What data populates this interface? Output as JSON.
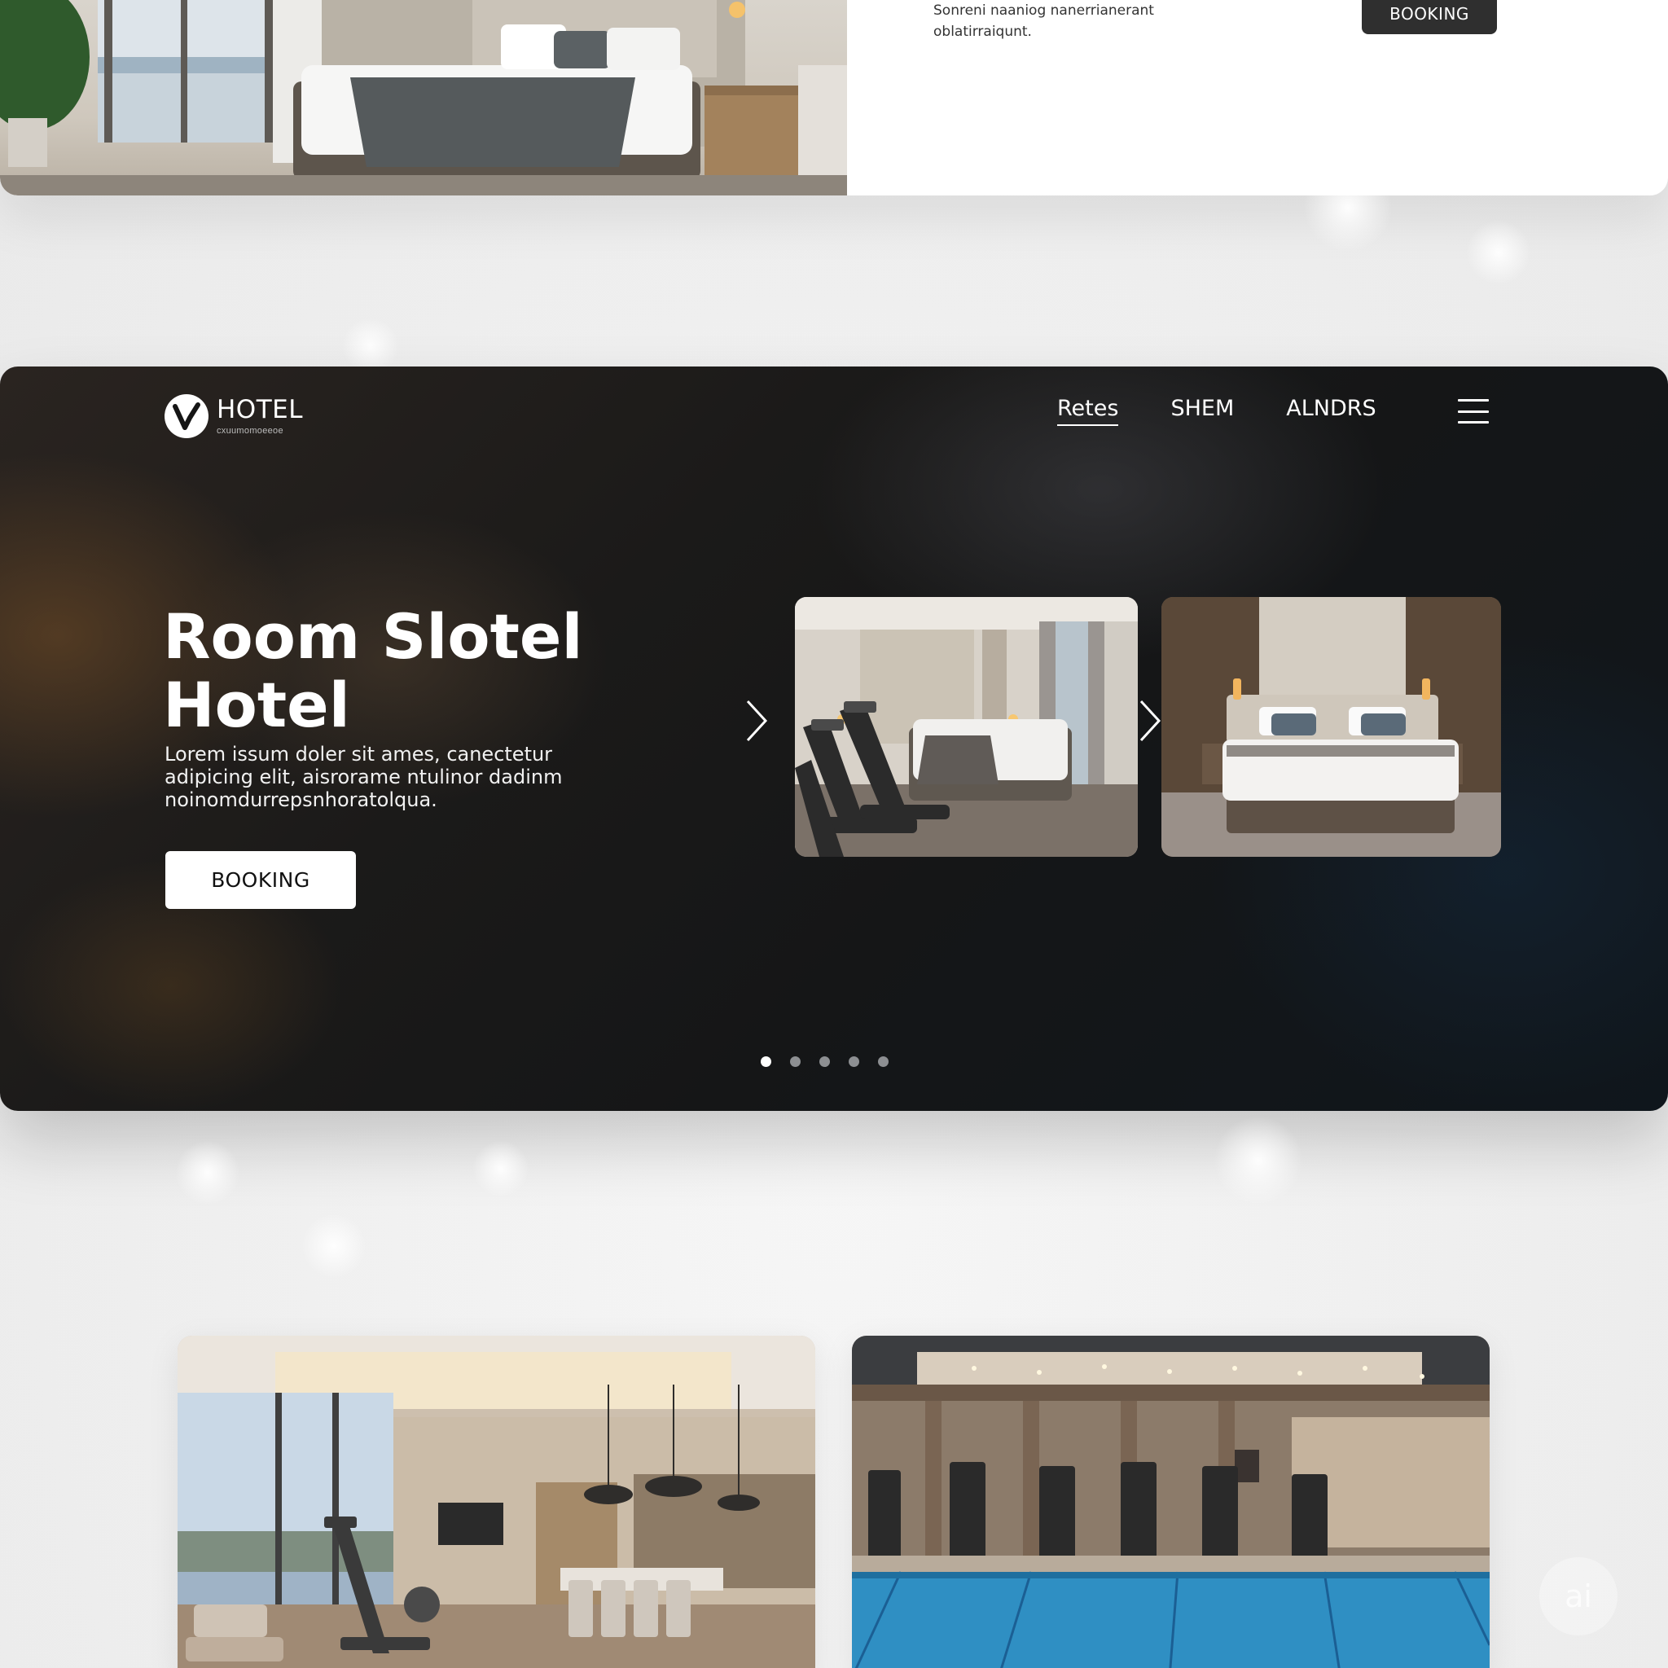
{
  "top_section": {
    "snippet_line1": "Sonreni naaniog nanerrianerant",
    "snippet_line2": "oblatirraiqunt.",
    "booking_label": "BOOKING"
  },
  "header": {
    "logo_name": "HOTEL",
    "logo_tagline": "cxuumomoeeoe",
    "nav": [
      "Retes",
      "SHEM",
      "ALNDRS"
    ],
    "active_nav_index": 0
  },
  "hero": {
    "title_line1": "Room Slotel",
    "title_line2": "Hotel",
    "desc_line1": "Lorem issum doler sit ames,  canectetur",
    "desc_line2": "adipicing elit, aisrorame ntulinor dadinm",
    "desc_line3": "noinomdurrepsnhoratolqua.",
    "booking_label": "BOOKING",
    "slides": [
      "gym-bedroom-suite",
      "deluxe-bedroom"
    ],
    "dots_count": 5,
    "active_dot": 0
  },
  "gallery": [
    "fitness-dining-lounge",
    "indoor-pool-gym"
  ],
  "watermark": "ai"
}
